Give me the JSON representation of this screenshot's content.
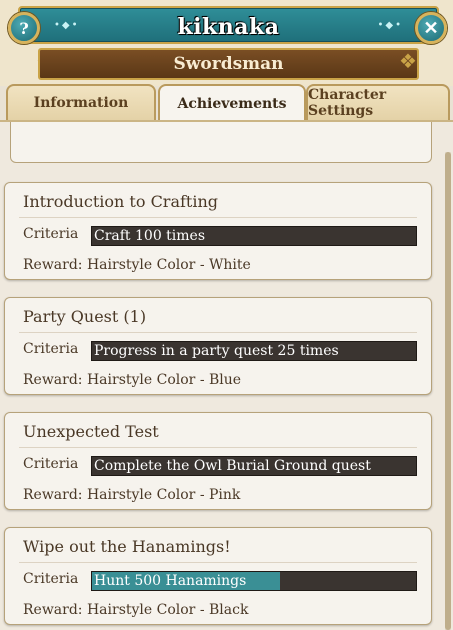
{
  "character": {
    "name": "kiknaka",
    "class": "Swordsman"
  },
  "header_buttons": {
    "help": "?",
    "close": "✕"
  },
  "tabs": [
    {
      "label": "Information",
      "active": false
    },
    {
      "label": "Achievements",
      "active": true
    },
    {
      "label": "Character Settings",
      "active": false
    }
  ],
  "achievements": [
    {
      "title": "Introduction to Crafting",
      "criteria_label": "Criteria",
      "criteria": "Craft 100 times",
      "progress": 0,
      "reward": "Reward: Hairstyle Color - White"
    },
    {
      "title": "Party Quest (1)",
      "criteria_label": "Criteria",
      "criteria": "Progress in a party quest 25 times",
      "progress": 0,
      "reward": "Reward: Hairstyle Color - Blue"
    },
    {
      "title": "Unexpected Test",
      "criteria_label": "Criteria",
      "criteria": "Complete the Owl Burial Ground quest",
      "progress": 0,
      "reward": "Reward: Hairstyle Color - Pink"
    },
    {
      "title": "Wipe out the Hanamings!",
      "criteria_label": "Criteria",
      "criteria": "Hunt 500 Hanamings",
      "progress": 0.58,
      "reward": "Reward: Hairstyle Color - Black"
    }
  ],
  "colors": {
    "progress_fill": "#3a8f95",
    "name_bar": "#1f6f7a",
    "class_plate": "#5a3716"
  }
}
